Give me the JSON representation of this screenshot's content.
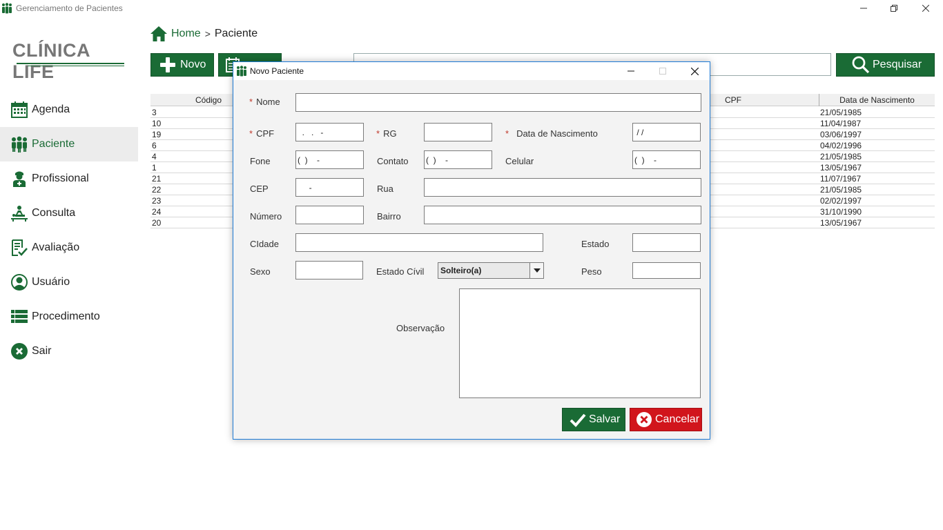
{
  "window": {
    "title": "Gerenciamento de Pacientes"
  },
  "logo": {
    "text": "CLÍNICA LIFE"
  },
  "sidebar": {
    "items": [
      {
        "label": "Agenda",
        "icon": "calendar-icon"
      },
      {
        "label": "Paciente",
        "icon": "patients-icon",
        "active": true
      },
      {
        "label": "Profissional",
        "icon": "doctor-icon"
      },
      {
        "label": "Consulta",
        "icon": "consultation-icon"
      },
      {
        "label": "Avaliação",
        "icon": "checklist-icon"
      },
      {
        "label": "Usuário",
        "icon": "user-icon"
      },
      {
        "label": "Procedimento",
        "icon": "list-icon"
      },
      {
        "label": "Sair",
        "icon": "exit-icon"
      }
    ]
  },
  "breadcrumb": {
    "home": "Home",
    "separator": ">",
    "current": "Paciente"
  },
  "toolbar": {
    "novo_label": "Novo",
    "search_label": "Pesquisar",
    "search_value": ""
  },
  "table": {
    "headers": {
      "code": "Código",
      "cpf": "CPF",
      "birth": "Data de Nascimento"
    },
    "rows": [
      {
        "code": "3",
        "birth": "21/05/1985"
      },
      {
        "code": "10",
        "birth": "11/04/1987"
      },
      {
        "code": "19",
        "birth": "03/06/1997"
      },
      {
        "code": "6",
        "birth": "04/02/1996"
      },
      {
        "code": "4",
        "birth": "21/05/1985"
      },
      {
        "code": "1",
        "birth": "13/05/1967"
      },
      {
        "code": "21",
        "birth": "11/07/1967"
      },
      {
        "code": "22",
        "birth": "21/05/1985"
      },
      {
        "code": "23",
        "birth": "02/02/1997"
      },
      {
        "code": "24",
        "birth": "31/10/1990"
      },
      {
        "code": "20",
        "birth": "13/05/1967"
      }
    ]
  },
  "modal": {
    "title": "Novo Paciente",
    "required_mark": "*",
    "labels": {
      "nome": "Nome",
      "cpf": "CPF",
      "rg": "RG",
      "nascimento": "Data de Nascimento",
      "fone": "Fone",
      "contato": "Contato",
      "celular": "Celular",
      "cep": "CEP",
      "rua": "Rua",
      "numero": "Número",
      "bairro": "Bairro",
      "cidade": "CIdade",
      "estado": "Estado",
      "sexo": "Sexo",
      "estado_civil": "Estado Cívil",
      "peso": "Peso",
      "observacao": "Observação"
    },
    "values": {
      "nome": "",
      "cpf": "  .   .   -",
      "rg": "",
      "nascimento": " / /",
      "fone": "(  )    -",
      "contato": "(  )    -",
      "celular": "(  )    -",
      "cep": "     -",
      "rua": "",
      "numero": "",
      "bairro": "",
      "cidade": "",
      "estado": "",
      "sexo": "",
      "estado_civil": "Solteiro(a)",
      "peso": "",
      "observacao": ""
    },
    "buttons": {
      "salvar": "Salvar",
      "cancelar": "Cancelar"
    }
  },
  "colors": {
    "brand_green": "#1a6b35",
    "danger_red": "#d1151c",
    "modal_border": "#1c7ad6"
  }
}
